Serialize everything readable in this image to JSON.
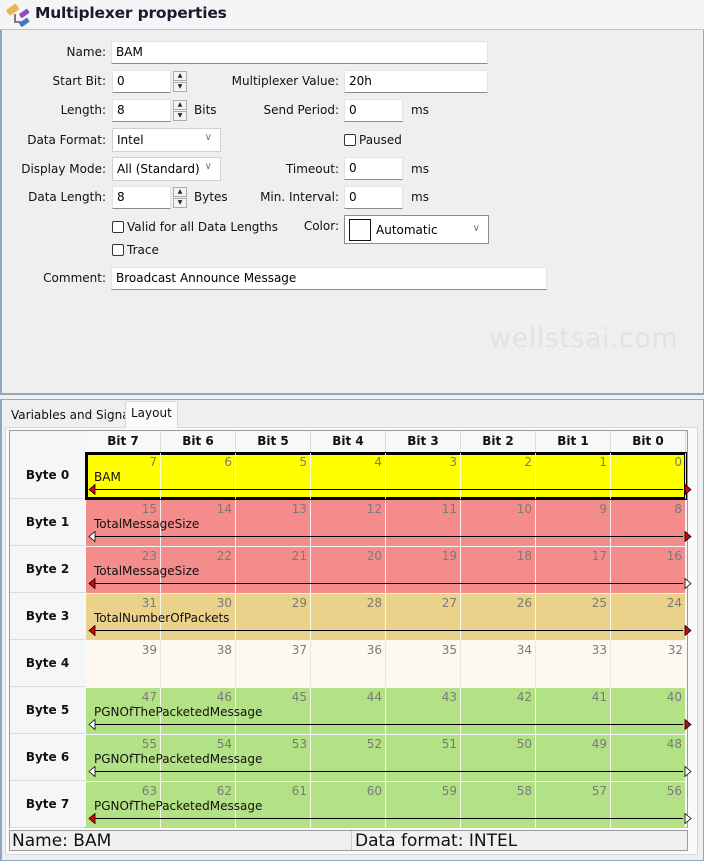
{
  "window": {
    "title": "Multiplexer properties",
    "icon": "multiplexer-icon"
  },
  "form": {
    "name": {
      "label": "Name:",
      "value": "BAM"
    },
    "start_bit": {
      "label": "Start Bit:",
      "value": "0"
    },
    "length": {
      "label": "Length:",
      "value": "8",
      "unit": "Bits"
    },
    "data_format": {
      "label": "Data Format:",
      "value": "Intel"
    },
    "display_mode": {
      "label": "Display Mode:",
      "value": "All (Standard)"
    },
    "data_length": {
      "label": "Data Length:",
      "value": "8",
      "unit": "Bytes"
    },
    "valid_all_lengths": {
      "label": "Valid for all Data Lengths",
      "checked": false
    },
    "trace": {
      "label": "Trace",
      "checked": false
    },
    "comment": {
      "label": "Comment:",
      "value": "Broadcast Announce Message"
    },
    "multiplexer_value": {
      "label": "Multiplexer Value:",
      "value": "20h"
    },
    "send_period": {
      "label": "Send Period:",
      "value": "0",
      "unit": "ms"
    },
    "paused": {
      "label": "Paused",
      "checked": false
    },
    "timeout": {
      "label": "Timeout:",
      "value": "0",
      "unit": "ms"
    },
    "min_interval": {
      "label": "Min. Interval:",
      "value": "0",
      "unit": "ms"
    },
    "color": {
      "label": "Color:",
      "value": "Automatic",
      "swatch": "#ffffff"
    }
  },
  "watermark": "wellstsai.com",
  "tabs": [
    {
      "label": "Variables and Signals",
      "active": false
    },
    {
      "label": "Layout",
      "active": true
    }
  ],
  "layout": {
    "bit_headers": [
      "Bit 7",
      "Bit 6",
      "Bit 5",
      "Bit 4",
      "Bit 3",
      "Bit 2",
      "Bit 1",
      "Bit 0"
    ],
    "rows": [
      {
        "label": "Byte 0",
        "bits": [
          "7",
          "6",
          "5",
          "4",
          "3",
          "2",
          "1",
          "0"
        ],
        "signal": "BAM",
        "color": "#ffff00",
        "selected": true,
        "arrow_start": "red",
        "arrow_end": "red"
      },
      {
        "label": "Byte 1",
        "bits": [
          "15",
          "14",
          "13",
          "12",
          "11",
          "10",
          "9",
          "8"
        ],
        "signal": "TotalMessageSize",
        "color": "#f48c8c",
        "selected": false,
        "arrow_start": "white",
        "arrow_end": "red"
      },
      {
        "label": "Byte 2",
        "bits": [
          "23",
          "22",
          "21",
          "20",
          "19",
          "18",
          "17",
          "16"
        ],
        "signal": "TotalMessageSize",
        "color": "#f48c8c",
        "selected": false,
        "arrow_start": "red",
        "arrow_end": "white"
      },
      {
        "label": "Byte 3",
        "bits": [
          "31",
          "30",
          "29",
          "28",
          "27",
          "26",
          "25",
          "24"
        ],
        "signal": "TotalNumberOfPackets",
        "color": "#ead28a",
        "selected": false,
        "arrow_start": "red",
        "arrow_end": "red"
      },
      {
        "label": "Byte 4",
        "bits": [
          "39",
          "38",
          "37",
          "36",
          "35",
          "34",
          "33",
          "32"
        ],
        "signal": "",
        "color": "#fdf9ee",
        "selected": false,
        "arrow_start": "",
        "arrow_end": ""
      },
      {
        "label": "Byte 5",
        "bits": [
          "47",
          "46",
          "45",
          "44",
          "43",
          "42",
          "41",
          "40"
        ],
        "signal": "PGNOfThePacketedMessage",
        "color": "#b3e186",
        "selected": false,
        "arrow_start": "white",
        "arrow_end": "red"
      },
      {
        "label": "Byte 6",
        "bits": [
          "55",
          "54",
          "53",
          "52",
          "51",
          "50",
          "49",
          "48"
        ],
        "signal": "PGNOfThePacketedMessage",
        "color": "#b3e186",
        "selected": false,
        "arrow_start": "white",
        "arrow_end": "white"
      },
      {
        "label": "Byte 7",
        "bits": [
          "63",
          "62",
          "61",
          "60",
          "59",
          "58",
          "57",
          "56"
        ],
        "signal": "PGNOfThePacketedMessage",
        "color": "#b3e186",
        "selected": false,
        "arrow_start": "red",
        "arrow_end": "white"
      }
    ]
  },
  "status": {
    "name": "Name: BAM",
    "data_format": "Data format: INTEL"
  }
}
